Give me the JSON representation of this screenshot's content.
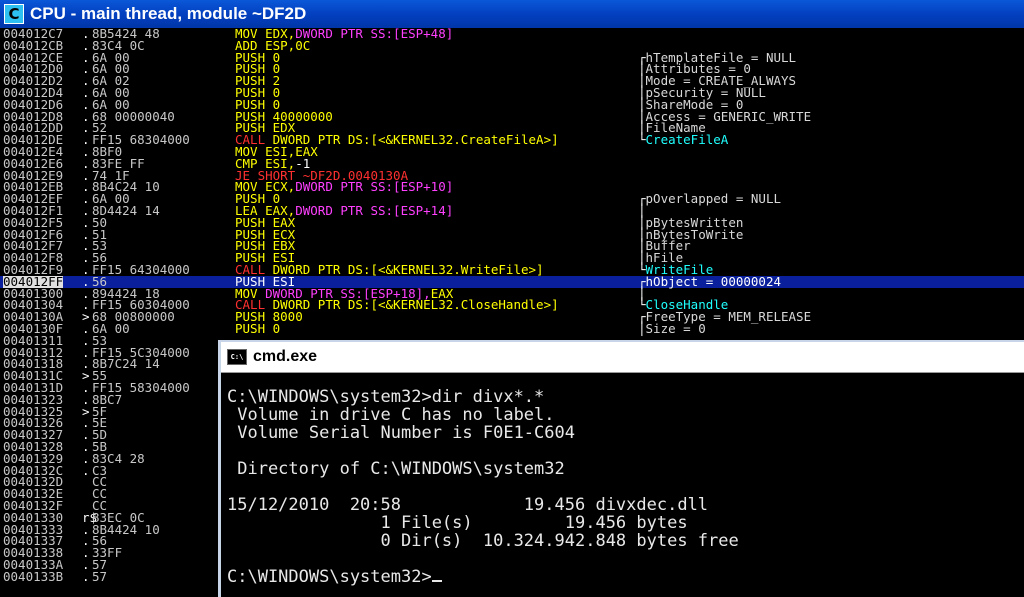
{
  "cpu_window": {
    "title": "CPU - main thread, module ~DF2D",
    "icon_letter": "C"
  },
  "disasm": [
    {
      "addr": "004012C7",
      "mark": ".",
      "hex": "8B5424 48",
      "ins": [
        [
          "MOV ",
          "y"
        ],
        [
          "EDX,",
          "y"
        ],
        [
          "DWORD PTR SS:[ESP+48]",
          "m"
        ]
      ],
      "cmt": []
    },
    {
      "addr": "004012CB",
      "mark": ".",
      "hex": "83C4 0C",
      "ins": [
        [
          "ADD ESP,",
          "y"
        ],
        [
          "0C",
          "y"
        ]
      ],
      "cmt": []
    },
    {
      "addr": "004012CE",
      "mark": ".",
      "hex": "6A 00",
      "ins": [
        [
          "PUSH 0",
          "y"
        ]
      ],
      "brk": "┌",
      "cmt": [
        [
          "hTemplateFile = NULL",
          "lg"
        ]
      ]
    },
    {
      "addr": "004012D0",
      "mark": ".",
      "hex": "6A 00",
      "ins": [
        [
          "PUSH 0",
          "y"
        ]
      ],
      "brk": "│",
      "cmt": [
        [
          "Attributes = 0",
          "lg"
        ]
      ]
    },
    {
      "addr": "004012D2",
      "mark": ".",
      "hex": "6A 02",
      "ins": [
        [
          "PUSH 2",
          "y"
        ]
      ],
      "brk": "│",
      "cmt": [
        [
          "Mode = CREATE_ALWAYS",
          "lg"
        ]
      ]
    },
    {
      "addr": "004012D4",
      "mark": ".",
      "hex": "6A 00",
      "ins": [
        [
          "PUSH 0",
          "y"
        ]
      ],
      "brk": "│",
      "cmt": [
        [
          "pSecurity = NULL",
          "lg"
        ]
      ]
    },
    {
      "addr": "004012D6",
      "mark": ".",
      "hex": "6A 00",
      "ins": [
        [
          "PUSH 0",
          "y"
        ]
      ],
      "brk": "│",
      "cmt": [
        [
          "ShareMode = 0",
          "lg"
        ]
      ]
    },
    {
      "addr": "004012D8",
      "mark": ".",
      "hex": "68 00000040",
      "ins": [
        [
          "PUSH 40000000",
          "y"
        ]
      ],
      "brk": "│",
      "cmt": [
        [
          "Access = GENERIC_WRITE",
          "lg"
        ]
      ]
    },
    {
      "addr": "004012DD",
      "mark": ".",
      "hex": "52",
      "ins": [
        [
          "PUSH EDX",
          "y"
        ]
      ],
      "brk": "│",
      "cmt": [
        [
          "FileName",
          "lg"
        ]
      ]
    },
    {
      "addr": "004012DE",
      "mark": ".",
      "hex": "FF15 68304000",
      "ins": [
        [
          "CALL ",
          "r"
        ],
        [
          "DWORD PTR DS:[<&KERNEL32.CreateFileA>]",
          "y"
        ]
      ],
      "brk": "└",
      "cmt": [
        [
          "CreateFileA",
          "cy"
        ]
      ]
    },
    {
      "addr": "004012E4",
      "mark": ".",
      "hex": "8BF0",
      "ins": [
        [
          "MOV ESI,EAX",
          "y"
        ]
      ],
      "cmt": []
    },
    {
      "addr": "004012E6",
      "mark": ".",
      "hex": "83FE FF",
      "ins": [
        [
          "CMP ESI,",
          "y"
        ],
        [
          "-1",
          "w"
        ]
      ],
      "cmt": []
    },
    {
      "addr": "004012E9",
      "mark": ".",
      "hex": "74 1F",
      "ins": [
        [
          "JE SHORT ~DF2D.0040130A",
          "r"
        ]
      ],
      "cmt": []
    },
    {
      "addr": "004012EB",
      "mark": ".",
      "hex": "8B4C24 10",
      "ins": [
        [
          "MOV ECX,",
          "y"
        ],
        [
          "DWORD PTR SS:[ESP+10]",
          "m"
        ]
      ],
      "cmt": []
    },
    {
      "addr": "004012EF",
      "mark": ".",
      "hex": "6A 00",
      "ins": [
        [
          "PUSH 0",
          "y"
        ]
      ],
      "brk": "┌",
      "cmt": [
        [
          "pOverlapped = NULL",
          "lg"
        ]
      ]
    },
    {
      "addr": "004012F1",
      "mark": ".",
      "hex": "8D4424 14",
      "ins": [
        [
          "LEA EAX,",
          "y"
        ],
        [
          "DWORD PTR SS:[ESP+14]",
          "m"
        ]
      ],
      "brk": "│",
      "cmt": []
    },
    {
      "addr": "004012F5",
      "mark": ".",
      "hex": "50",
      "ins": [
        [
          "PUSH EAX",
          "y"
        ]
      ],
      "brk": "│",
      "cmt": [
        [
          "pBytesWritten",
          "lg"
        ]
      ]
    },
    {
      "addr": "004012F6",
      "mark": ".",
      "hex": "51",
      "ins": [
        [
          "PUSH ECX",
          "y"
        ]
      ],
      "brk": "│",
      "cmt": [
        [
          "nBytesToWrite",
          "lg"
        ]
      ]
    },
    {
      "addr": "004012F7",
      "mark": ".",
      "hex": "53",
      "ins": [
        [
          "PUSH EBX",
          "y"
        ]
      ],
      "brk": "│",
      "cmt": [
        [
          "Buffer",
          "lg"
        ]
      ]
    },
    {
      "addr": "004012F8",
      "mark": ".",
      "hex": "56",
      "ins": [
        [
          "PUSH ESI",
          "y"
        ]
      ],
      "brk": "│",
      "cmt": [
        [
          "hFile",
          "lg"
        ]
      ]
    },
    {
      "addr": "004012F9",
      "mark": ".",
      "hex": "FF15 64304000",
      "ins": [
        [
          "CALL ",
          "r"
        ],
        [
          "DWORD PTR DS:[<&KERNEL32.WriteFile>]",
          "y"
        ]
      ],
      "brk": "└",
      "cmt": [
        [
          "WriteFile",
          "cy"
        ]
      ]
    },
    {
      "addr": "004012FF",
      "mark": ".",
      "hex": "56",
      "sel": true,
      "ins": [
        [
          "PUSH ESI",
          "w"
        ]
      ],
      "brk": "┌",
      "cmt": [
        [
          "hObject = 00000024",
          "w"
        ]
      ]
    },
    {
      "addr": "00401300",
      "mark": ".",
      "hex": "894424 18",
      "ins": [
        [
          "MOV ",
          "y"
        ],
        [
          "DWORD PTR SS:[ESP+18],",
          "m"
        ],
        [
          "EAX",
          "y"
        ]
      ],
      "brk": "│",
      "cmt": []
    },
    {
      "addr": "00401304",
      "mark": ".",
      "hex": "FF15 60304000",
      "ins": [
        [
          "CALL ",
          "r"
        ],
        [
          "DWORD PTR DS:[<&KERNEL32.CloseHandle>]",
          "y"
        ]
      ],
      "brk": "└",
      "cmt": [
        [
          "CloseHandle",
          "cy"
        ]
      ]
    },
    {
      "addr": "0040130A",
      "mark": ">",
      "hex": "68 00800000",
      "ins": [
        [
          "PUSH 8000",
          "y"
        ]
      ],
      "brk": "┌",
      "cmt": [
        [
          "FreeType = MEM_RELEASE",
          "lg"
        ]
      ]
    },
    {
      "addr": "0040130F",
      "mark": ".",
      "hex": "6A 00",
      "ins": [
        [
          "PUSH 0",
          "y"
        ]
      ],
      "brk": "│",
      "cmt": [
        [
          "Size = 0",
          "lg"
        ]
      ]
    },
    {
      "addr": "00401311",
      "mark": ".",
      "hex": "53",
      "ins": [],
      "cmt": []
    },
    {
      "addr": "00401312",
      "mark": ".",
      "hex": "FF15 5C304000",
      "ins": [],
      "cmt": []
    },
    {
      "addr": "00401318",
      "mark": ".",
      "hex": "8B7C24 14",
      "ins": [],
      "cmt": []
    },
    {
      "addr": "0040131C",
      "mark": ">",
      "hex": "55",
      "ins": [],
      "cmt": []
    },
    {
      "addr": "0040131D",
      "mark": ".",
      "hex": "FF15 58304000",
      "ins": [],
      "cmt": []
    },
    {
      "addr": "00401323",
      "mark": ".",
      "hex": "8BC7",
      "ins": [],
      "cmt": []
    },
    {
      "addr": "00401325",
      "mark": ">",
      "hex": "5F",
      "ins": [],
      "cmt": []
    },
    {
      "addr": "00401326",
      "mark": ".",
      "hex": "5E",
      "ins": [],
      "cmt": []
    },
    {
      "addr": "00401327",
      "mark": ".",
      "hex": "5D",
      "ins": [],
      "cmt": []
    },
    {
      "addr": "00401328",
      "mark": ".",
      "hex": "5B",
      "ins": [],
      "cmt": []
    },
    {
      "addr": "00401329",
      "mark": ".",
      "hex": "83C4 28",
      "ins": [],
      "cmt": []
    },
    {
      "addr": "0040132C",
      "mark": ".",
      "hex": "C3",
      "ins": [],
      "cmt": []
    },
    {
      "addr": "0040132D",
      "mark": "",
      "hex": "CC",
      "ins": [],
      "cmt": []
    },
    {
      "addr": "0040132E",
      "mark": "",
      "hex": "CC",
      "ins": [],
      "cmt": []
    },
    {
      "addr": "0040132F",
      "mark": "",
      "hex": "CC",
      "ins": [],
      "cmt": []
    },
    {
      "addr": "00401330",
      "mark": "r$",
      "hex": "83EC 0C",
      "ins": [],
      "cmt": []
    },
    {
      "addr": "00401333",
      "mark": ".",
      "hex": "8B4424 10",
      "ins": [],
      "cmt": []
    },
    {
      "addr": "00401337",
      "mark": ".",
      "hex": "56",
      "ins": [],
      "cmt": []
    },
    {
      "addr": "00401338",
      "mark": ".",
      "hex": "33FF",
      "ins": [],
      "cmt": []
    },
    {
      "addr": "0040133A",
      "mark": ".",
      "hex": "57",
      "ins": [],
      "cmt": []
    },
    {
      "addr": "0040133B",
      "mark": ".",
      "hex": "57",
      "ins": [],
      "cmt": []
    }
  ],
  "cmd_window": {
    "title": "cmd.exe",
    "icon_label": "C:\\",
    "lines": [
      "C:\\WINDOWS\\system32>dir divx*.*",
      " Volume in drive C has no label.",
      " Volume Serial Number is F0E1-C604",
      "",
      " Directory of C:\\WINDOWS\\system32",
      "",
      "15/12/2010  20:58            19.456 divxdec.dll",
      "               1 File(s)         19.456 bytes",
      "               0 Dir(s)  10.324.942.848 bytes free",
      "",
      "C:\\WINDOWS\\system32>"
    ]
  }
}
